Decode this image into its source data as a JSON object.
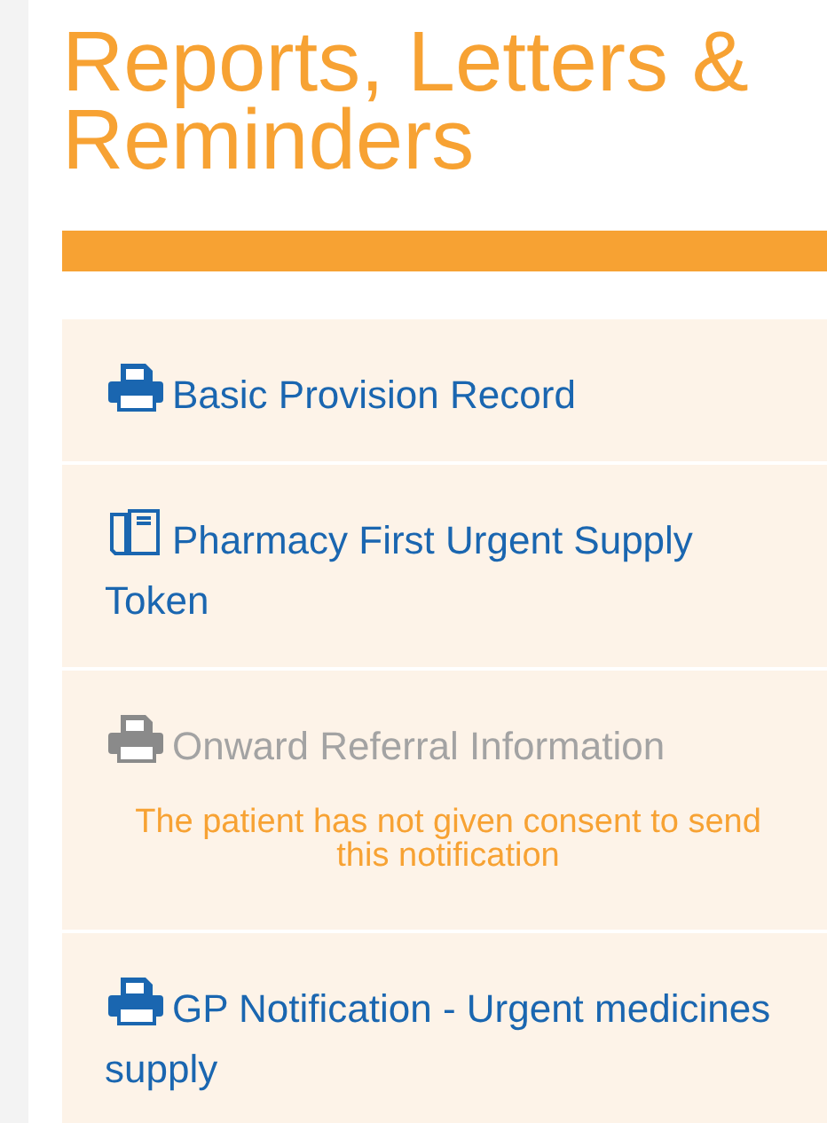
{
  "title": "Reports, Letters & Reminders",
  "items": [
    {
      "kind": "print",
      "label": "Basic Provision Record",
      "disabled": false
    },
    {
      "kind": "token",
      "label": "Pharmacy First Urgent Supply Token",
      "disabled": false
    },
    {
      "kind": "print",
      "label": "Onward Referral Information",
      "disabled": true,
      "note": "The patient has not given consent to send this notification"
    },
    {
      "kind": "print",
      "label": "GP Notification - Urgent medicines supply",
      "disabled": false
    }
  ]
}
